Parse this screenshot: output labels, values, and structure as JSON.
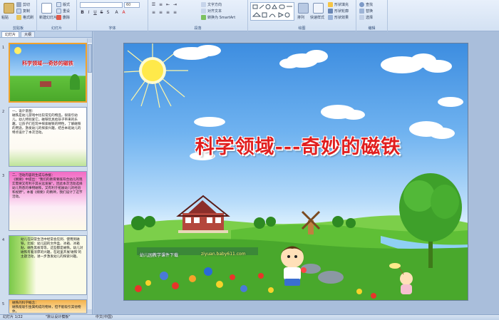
{
  "ribbon": {
    "clipboard": {
      "label": "剪贴板",
      "paste": "粘贴",
      "cut": "剪切",
      "copy": "复制",
      "format": "格式刷"
    },
    "slides": {
      "label": "幻灯片",
      "new_slide": "新建幻灯片",
      "layout": "版式",
      "reset": "重设",
      "delete": "删除"
    },
    "font": {
      "label": "字体",
      "font_name": "",
      "font_size": "60"
    },
    "paragraph": {
      "label": "段落",
      "text_direction": "文字方向",
      "align_text": "对齐文本",
      "smartart": "转换为 SmartArt"
    },
    "drawing": {
      "label": "绘图",
      "arrange": "排列",
      "quick_styles": "快速样式",
      "shape_fill": "形状填充",
      "shape_outline": "形状轮廓",
      "shape_effects": "形状效果"
    },
    "editing": {
      "label": "编辑",
      "find": "查找",
      "replace": "替换",
      "select": "选择"
    }
  },
  "left_pane": {
    "tabs": [
      "幻灯片",
      "大纲"
    ],
    "thumbs": [
      {
        "num": "1",
        "title": "科学领域---奇妙的磁铁"
      },
      {
        "num": "2",
        "text": "一、设计意图：\n磁铁是幼儿游戏中比较常见的物品，很吸引幼儿，幼儿特别爱它。磁铁玩具给孩子带来的乐趣，让孩子们在玩中探索磁铁的特性，了解磁铁的用途，激发幼儿的探索兴趣，结合本班幼儿的特点设计了本次活动。"
      },
      {
        "num": "3",
        "text": "二、活动内容的生成与依据：\n《纲要》中提出：\"我们的教育要既符合幼儿的现实需要又有利于其长远发展\"。因此本次活动选择幼儿熟悉的事物磁铁，又有利于拓展幼儿的经验和视野\"。本着《纲要》的精神，我们设计了这节活动。"
      },
      {
        "num": "4",
        "text": "幼儿在日常生活中经常会见到、使用到磁铁，比如：幼儿园的文件盒、冰箱、冰箱贴、磁性黑板等等，这些都是磁铁。幼儿对磁铁有着浓厚的兴趣，在班里开展'磁铁'的主题活动，进一步激发幼儿的探索兴趣。"
      },
      {
        "num": "5",
        "text": "磁铁的科学概念：\n磁铁能吸引金属构成的物体，但不能吸引其他物体。"
      }
    ]
  },
  "slide": {
    "title": "科学领域---奇妙的磁铁",
    "banner": "幼儿园教学课件下载",
    "site": "ziyuan.baby611.com"
  },
  "status": {
    "slide_info": "幻灯片 1/22",
    "theme": "\"默认设计模板\"",
    "language": "中文(中国)"
  },
  "colors": {
    "title_red": "#e11f1f",
    "sky_top": "#3d8de0",
    "grass": "#5fbf36",
    "ribbon_bg": "#dbe6f5"
  }
}
